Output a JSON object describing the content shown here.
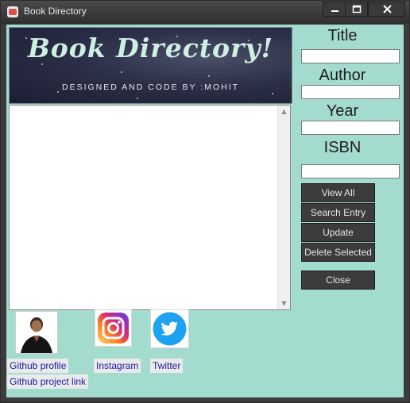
{
  "window": {
    "title": "Book Directory"
  },
  "banner": {
    "title": "Book Directory!",
    "subtitle": "DESIGNED AND CODE BY :MOHIT"
  },
  "form": {
    "title_label": "Title",
    "author_label": "Author",
    "year_label": "Year",
    "isbn_label": "ISBN",
    "title_value": "",
    "author_value": "",
    "year_value": "",
    "isbn_value": ""
  },
  "buttons": {
    "view_all": "View All",
    "search_entry": "Search Entry",
    "update": "Update",
    "delete_selected": "Delete Selected",
    "close": "Close"
  },
  "links": {
    "github_profile": "Github profile",
    "github_project": "Github project link",
    "instagram": "Instagram",
    "twitter": "Twitter"
  },
  "colors": {
    "background": "#a3dccf",
    "button": "#3c3c3c",
    "link_text": "#1a1aa6",
    "instagram_gradient": "#feda75,#d62976,#962fbf,#4f5bd5",
    "twitter_blue": "#1da1f2"
  },
  "icons": [
    "app-icon",
    "minimize-icon",
    "maximize-icon",
    "close-icon",
    "profile-photo",
    "instagram-icon",
    "twitter-icon",
    "scroll-up-arrow",
    "scroll-down-arrow"
  ]
}
